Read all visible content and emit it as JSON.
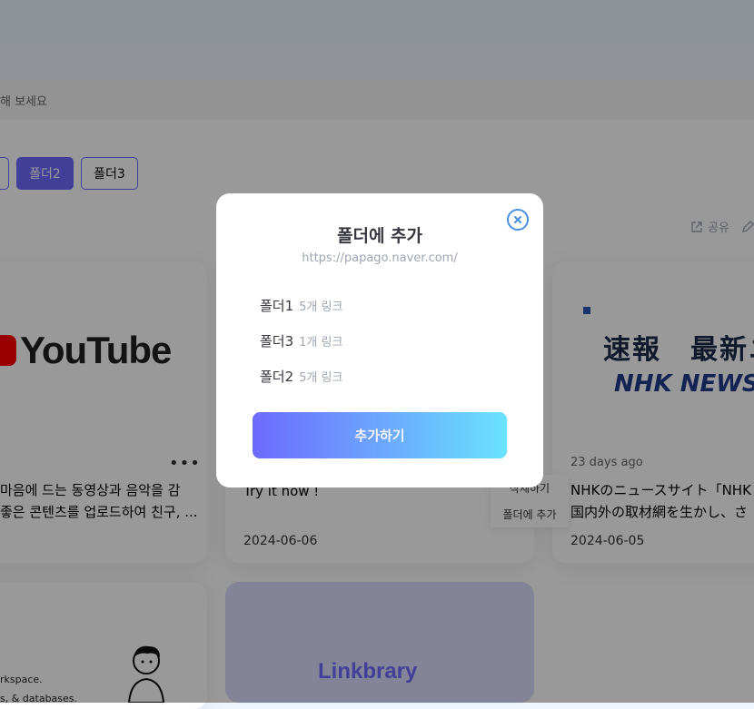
{
  "search": {
    "placeholder_visible": "해 보세요"
  },
  "folders": [
    {
      "label": ""
    },
    {
      "label": "폴더2"
    },
    {
      "label": "폴더3"
    }
  ],
  "folder_tools": {
    "share": "공유"
  },
  "cards": [
    {
      "brand": "YouTube",
      "description_line1": "마음에 드는 동영상과 음악을 감",
      "description_line2": "좋은 콘텐츠를 업로드하여 친구, ..."
    },
    {
      "description": "Try it now !",
      "date": "2024-06-06"
    },
    {
      "image_text_1": "速報　最新ニ",
      "image_text_2": "NHK NEWS",
      "ago": "23 days ago",
      "description_line1": "NHKのニュースサイト「NHK N",
      "description_line2": "国内外の取材網を生かし、さ",
      "date": "2024-06-05"
    }
  ],
  "popover": {
    "delete": "삭제하기",
    "add_to_folder": "폴더에 추가"
  },
  "bottom_cards": {
    "illus_line1": "rkspace.",
    "illus_line2": "s, & databases.",
    "linkbrary": "Linkbrary"
  },
  "modal": {
    "title": "폴더에 추가",
    "url": "https://papago.naver.com/",
    "folders": [
      {
        "name": "폴더1",
        "count": "5개 링크"
      },
      {
        "name": "폴더3",
        "count": "1개 링크"
      },
      {
        "name": "폴더2",
        "count": "5개 링크"
      }
    ],
    "add_button": "추가하기"
  },
  "colors": {
    "primary": "#6d6afe",
    "gradient_end": "#6ae3fe",
    "close_icon": "#4a90e2"
  },
  "icons": {
    "close": "close-circle-icon",
    "share": "share-icon",
    "edit": "pencil-icon",
    "more": "kebab-icon"
  }
}
